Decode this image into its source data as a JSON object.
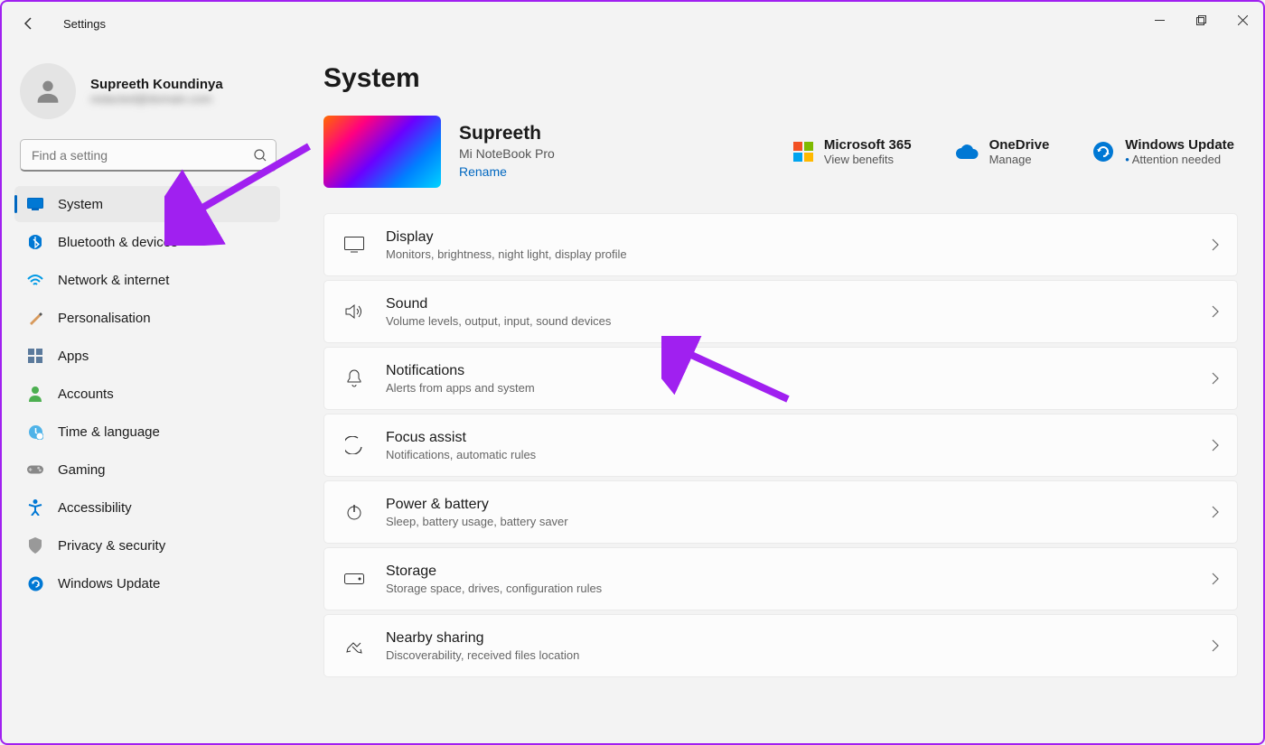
{
  "app": {
    "title": "Settings"
  },
  "user": {
    "name": "Supreeth Koundinya",
    "email_placeholder": "redacted@domain.com"
  },
  "search": {
    "placeholder": "Find a setting"
  },
  "sidebar": {
    "items": [
      {
        "label": "System",
        "icon": "system",
        "selected": true
      },
      {
        "label": "Bluetooth & devices",
        "icon": "bluetooth"
      },
      {
        "label": "Network & internet",
        "icon": "network"
      },
      {
        "label": "Personalisation",
        "icon": "personalisation"
      },
      {
        "label": "Apps",
        "icon": "apps"
      },
      {
        "label": "Accounts",
        "icon": "accounts"
      },
      {
        "label": "Time & language",
        "icon": "time"
      },
      {
        "label": "Gaming",
        "icon": "gaming"
      },
      {
        "label": "Accessibility",
        "icon": "accessibility"
      },
      {
        "label": "Privacy & security",
        "icon": "privacy"
      },
      {
        "label": "Windows Update",
        "icon": "update"
      }
    ]
  },
  "page": {
    "title": "System"
  },
  "device": {
    "name": "Supreeth",
    "model": "Mi NoteBook Pro",
    "rename": "Rename"
  },
  "hero_cards": [
    {
      "title": "Microsoft 365",
      "sub": "View benefits",
      "icon": "ms365"
    },
    {
      "title": "OneDrive",
      "sub": "Manage",
      "icon": "onedrive"
    },
    {
      "title": "Windows Update",
      "sub": "Attention needed",
      "icon": "winupdate",
      "dot": true
    }
  ],
  "settings": [
    {
      "title": "Display",
      "desc": "Monitors, brightness, night light, display profile",
      "icon": "display"
    },
    {
      "title": "Sound",
      "desc": "Volume levels, output, input, sound devices",
      "icon": "sound"
    },
    {
      "title": "Notifications",
      "desc": "Alerts from apps and system",
      "icon": "notifications"
    },
    {
      "title": "Focus assist",
      "desc": "Notifications, automatic rules",
      "icon": "focus"
    },
    {
      "title": "Power & battery",
      "desc": "Sleep, battery usage, battery saver",
      "icon": "power"
    },
    {
      "title": "Storage",
      "desc": "Storage space, drives, configuration rules",
      "icon": "storage"
    },
    {
      "title": "Nearby sharing",
      "desc": "Discoverability, received files location",
      "icon": "nearby"
    }
  ]
}
